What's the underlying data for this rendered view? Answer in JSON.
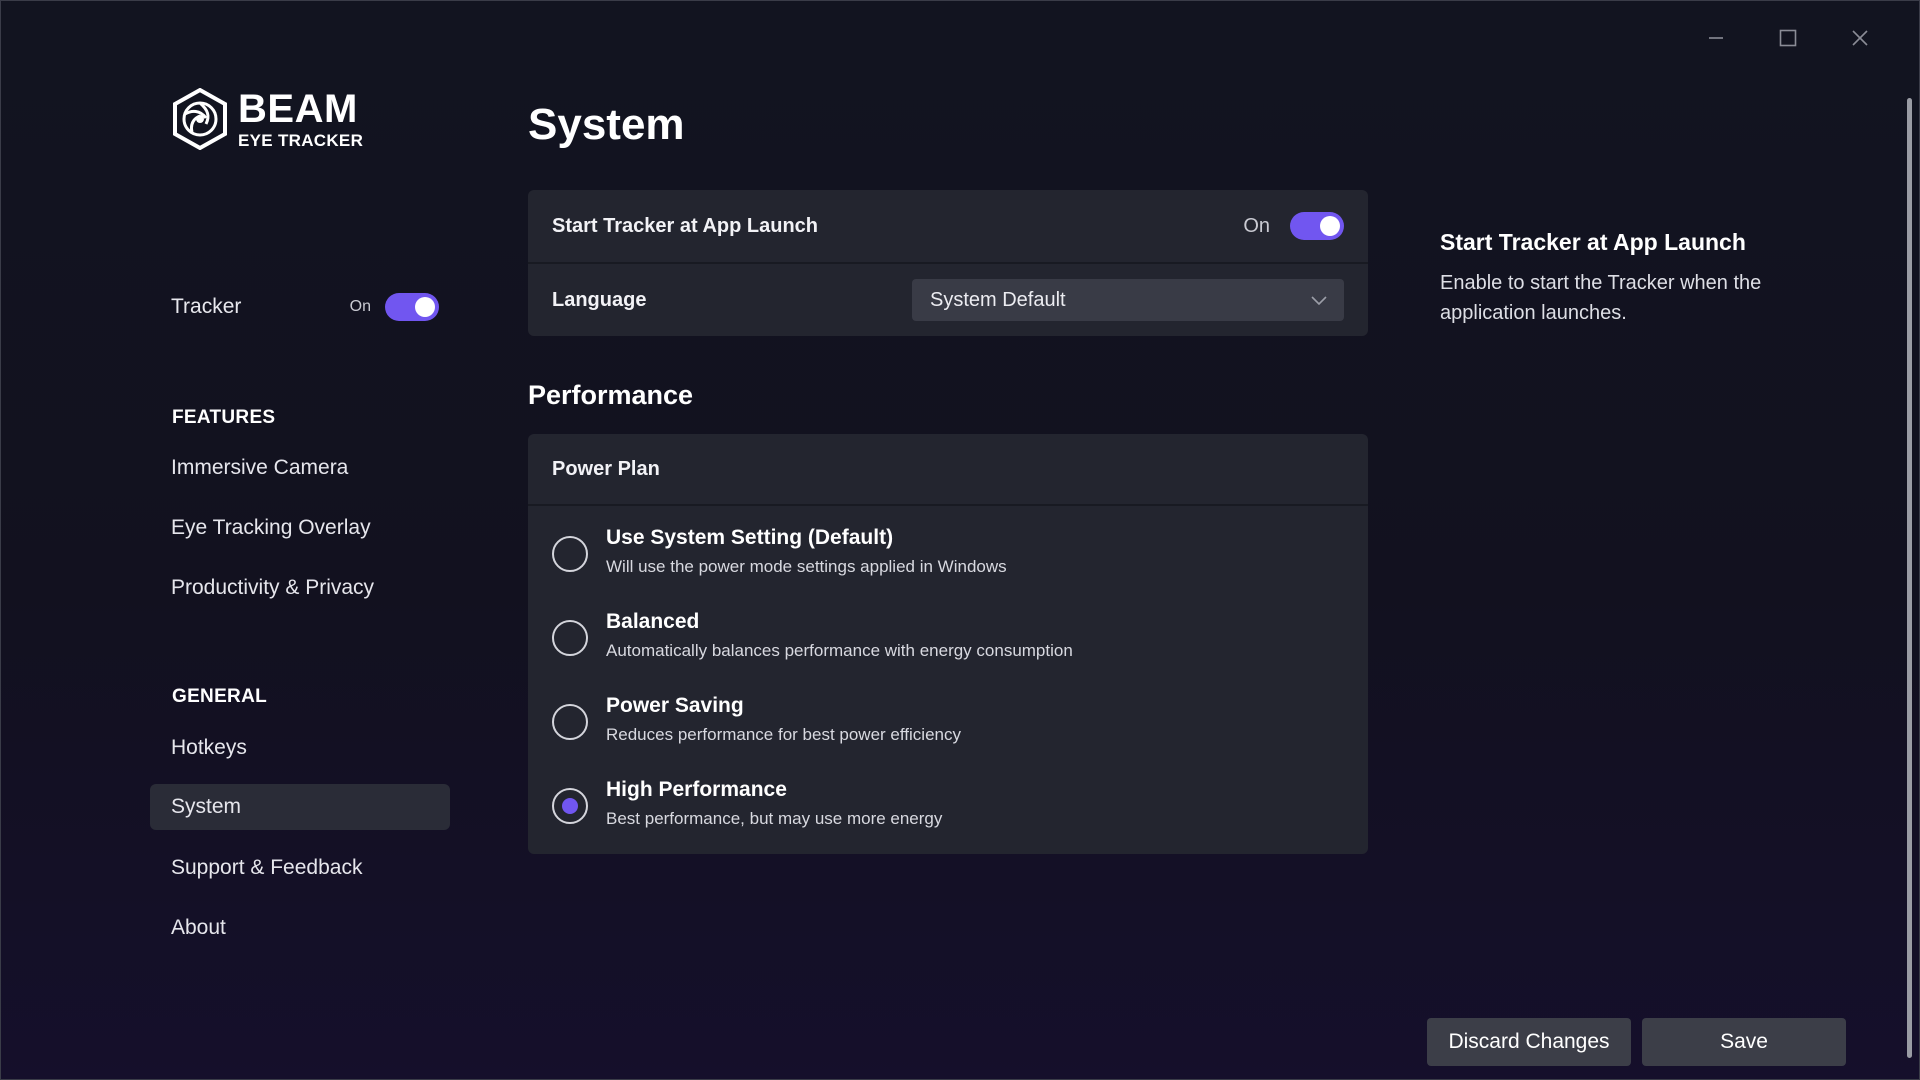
{
  "window": {
    "controls": [
      "minimize-icon",
      "maximize-icon",
      "close-icon"
    ]
  },
  "brand": {
    "name": "BEAM",
    "tagline": "EYE TRACKER"
  },
  "sidebar": {
    "tracker": {
      "label": "Tracker",
      "state": "On",
      "enabled": true
    },
    "features_heading": "FEATURES",
    "features": [
      {
        "label": "Immersive Camera"
      },
      {
        "label": "Eye Tracking Overlay"
      },
      {
        "label": "Productivity & Privacy"
      }
    ],
    "general_heading": "GENERAL",
    "general": [
      {
        "label": "Hotkeys",
        "active": false
      },
      {
        "label": "System",
        "active": true
      },
      {
        "label": "Support & Feedback",
        "active": false
      },
      {
        "label": "About",
        "active": false
      }
    ]
  },
  "main": {
    "title": "System",
    "start_tracker": {
      "label": "Start Tracker at App Launch",
      "state": "On",
      "enabled": true
    },
    "language": {
      "label": "Language",
      "value": "System Default"
    },
    "performance_title": "Performance",
    "power_plan": {
      "label": "Power Plan",
      "options": [
        {
          "title": "Use System Setting (Default)",
          "desc": "Will use the power mode settings applied in Windows",
          "selected": false
        },
        {
          "title": "Balanced",
          "desc": "Automatically balances performance with energy consumption",
          "selected": false
        },
        {
          "title": "Power Saving",
          "desc": "Reduces performance for best power efficiency",
          "selected": false
        },
        {
          "title": "High Performance",
          "desc": "Best performance, but may use more energy",
          "selected": true
        }
      ]
    }
  },
  "info_panel": {
    "title": "Start Tracker at App Launch",
    "description": "Enable to start the Tracker when the application launches."
  },
  "footer": {
    "discard_label": "Discard Changes",
    "save_label": "Save"
  },
  "colors": {
    "accent": "#7156f0",
    "card": "#23252f",
    "button": "#3c3e48"
  }
}
